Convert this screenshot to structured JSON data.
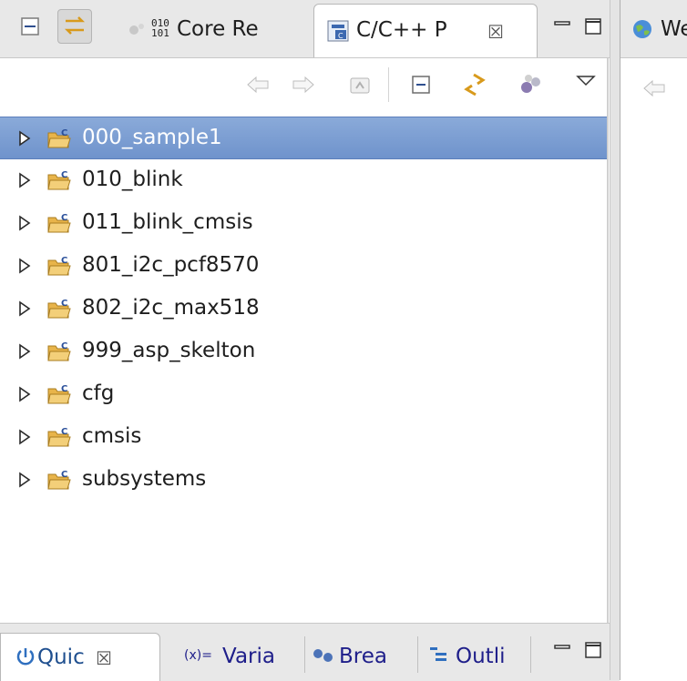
{
  "left_view": {
    "tabs": [
      {
        "label": "Core Re",
        "icon": "core-registers-icon"
      },
      {
        "label": "C/C++ P",
        "icon": "cpp-projects-icon",
        "close_glyph": "☒"
      }
    ],
    "toolbar_icons": [
      "back-arrow-icon",
      "forward-arrow-icon",
      "up-folder-icon",
      "collapse-all-icon",
      "link-with-editor-icon",
      "filter-icon",
      "view-menu-icon"
    ],
    "tree": [
      {
        "label": "000_sample1",
        "selected": true
      },
      {
        "label": "010_blink"
      },
      {
        "label": "011_blink_cmsis"
      },
      {
        "label": "801_i2c_pcf8570"
      },
      {
        "label": "802_i2c_max518"
      },
      {
        "label": "999_asp_skelton"
      },
      {
        "label": "cfg"
      },
      {
        "label": "cmsis"
      },
      {
        "label": "subsystems"
      }
    ]
  },
  "bottom_tabs": [
    {
      "label": "Quic",
      "close_glyph": "☒",
      "icon": "quick-access-icon"
    },
    {
      "label": "Varia",
      "icon_text": "(x)="
    },
    {
      "label": "Brea",
      "icon": "breakpoints-icon"
    },
    {
      "label": "Outli",
      "icon": "outline-icon"
    }
  ],
  "right_view": {
    "tab_label": "We",
    "icon": "globe-icon"
  },
  "colors": {
    "selection": "#7b9dd3",
    "tabbar": "#e8e8e8",
    "folder": "#e8b44a"
  }
}
